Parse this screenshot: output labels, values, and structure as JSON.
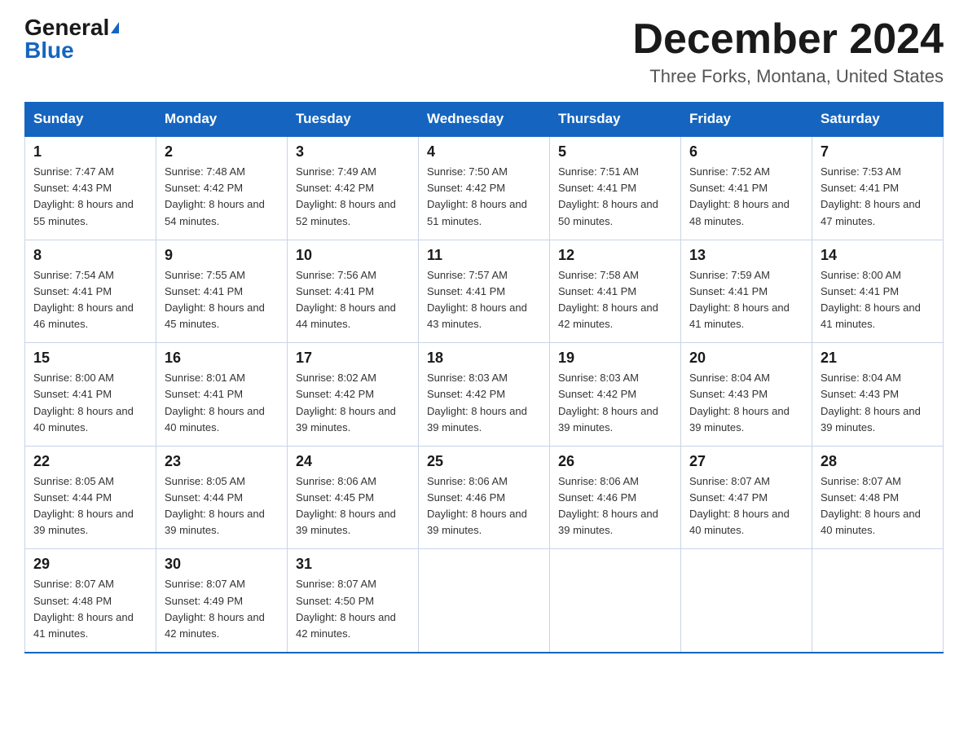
{
  "header": {
    "logo_general": "General",
    "logo_triangle": "▲",
    "logo_blue": "Blue",
    "month_title": "December 2024",
    "location": "Three Forks, Montana, United States"
  },
  "days_of_week": [
    "Sunday",
    "Monday",
    "Tuesday",
    "Wednesday",
    "Thursday",
    "Friday",
    "Saturday"
  ],
  "weeks": [
    [
      {
        "day": 1,
        "sunrise": "7:47 AM",
        "sunset": "4:43 PM",
        "daylight": "8 hours and 55 minutes."
      },
      {
        "day": 2,
        "sunrise": "7:48 AM",
        "sunset": "4:42 PM",
        "daylight": "8 hours and 54 minutes."
      },
      {
        "day": 3,
        "sunrise": "7:49 AM",
        "sunset": "4:42 PM",
        "daylight": "8 hours and 52 minutes."
      },
      {
        "day": 4,
        "sunrise": "7:50 AM",
        "sunset": "4:42 PM",
        "daylight": "8 hours and 51 minutes."
      },
      {
        "day": 5,
        "sunrise": "7:51 AM",
        "sunset": "4:41 PM",
        "daylight": "8 hours and 50 minutes."
      },
      {
        "day": 6,
        "sunrise": "7:52 AM",
        "sunset": "4:41 PM",
        "daylight": "8 hours and 48 minutes."
      },
      {
        "day": 7,
        "sunrise": "7:53 AM",
        "sunset": "4:41 PM",
        "daylight": "8 hours and 47 minutes."
      }
    ],
    [
      {
        "day": 8,
        "sunrise": "7:54 AM",
        "sunset": "4:41 PM",
        "daylight": "8 hours and 46 minutes."
      },
      {
        "day": 9,
        "sunrise": "7:55 AM",
        "sunset": "4:41 PM",
        "daylight": "8 hours and 45 minutes."
      },
      {
        "day": 10,
        "sunrise": "7:56 AM",
        "sunset": "4:41 PM",
        "daylight": "8 hours and 44 minutes."
      },
      {
        "day": 11,
        "sunrise": "7:57 AM",
        "sunset": "4:41 PM",
        "daylight": "8 hours and 43 minutes."
      },
      {
        "day": 12,
        "sunrise": "7:58 AM",
        "sunset": "4:41 PM",
        "daylight": "8 hours and 42 minutes."
      },
      {
        "day": 13,
        "sunrise": "7:59 AM",
        "sunset": "4:41 PM",
        "daylight": "8 hours and 41 minutes."
      },
      {
        "day": 14,
        "sunrise": "8:00 AM",
        "sunset": "4:41 PM",
        "daylight": "8 hours and 41 minutes."
      }
    ],
    [
      {
        "day": 15,
        "sunrise": "8:00 AM",
        "sunset": "4:41 PM",
        "daylight": "8 hours and 40 minutes."
      },
      {
        "day": 16,
        "sunrise": "8:01 AM",
        "sunset": "4:41 PM",
        "daylight": "8 hours and 40 minutes."
      },
      {
        "day": 17,
        "sunrise": "8:02 AM",
        "sunset": "4:42 PM",
        "daylight": "8 hours and 39 minutes."
      },
      {
        "day": 18,
        "sunrise": "8:03 AM",
        "sunset": "4:42 PM",
        "daylight": "8 hours and 39 minutes."
      },
      {
        "day": 19,
        "sunrise": "8:03 AM",
        "sunset": "4:42 PM",
        "daylight": "8 hours and 39 minutes."
      },
      {
        "day": 20,
        "sunrise": "8:04 AM",
        "sunset": "4:43 PM",
        "daylight": "8 hours and 39 minutes."
      },
      {
        "day": 21,
        "sunrise": "8:04 AM",
        "sunset": "4:43 PM",
        "daylight": "8 hours and 39 minutes."
      }
    ],
    [
      {
        "day": 22,
        "sunrise": "8:05 AM",
        "sunset": "4:44 PM",
        "daylight": "8 hours and 39 minutes."
      },
      {
        "day": 23,
        "sunrise": "8:05 AM",
        "sunset": "4:44 PM",
        "daylight": "8 hours and 39 minutes."
      },
      {
        "day": 24,
        "sunrise": "8:06 AM",
        "sunset": "4:45 PM",
        "daylight": "8 hours and 39 minutes."
      },
      {
        "day": 25,
        "sunrise": "8:06 AM",
        "sunset": "4:46 PM",
        "daylight": "8 hours and 39 minutes."
      },
      {
        "day": 26,
        "sunrise": "8:06 AM",
        "sunset": "4:46 PM",
        "daylight": "8 hours and 39 minutes."
      },
      {
        "day": 27,
        "sunrise": "8:07 AM",
        "sunset": "4:47 PM",
        "daylight": "8 hours and 40 minutes."
      },
      {
        "day": 28,
        "sunrise": "8:07 AM",
        "sunset": "4:48 PM",
        "daylight": "8 hours and 40 minutes."
      }
    ],
    [
      {
        "day": 29,
        "sunrise": "8:07 AM",
        "sunset": "4:48 PM",
        "daylight": "8 hours and 41 minutes."
      },
      {
        "day": 30,
        "sunrise": "8:07 AM",
        "sunset": "4:49 PM",
        "daylight": "8 hours and 42 minutes."
      },
      {
        "day": 31,
        "sunrise": "8:07 AM",
        "sunset": "4:50 PM",
        "daylight": "8 hours and 42 minutes."
      },
      null,
      null,
      null,
      null
    ]
  ]
}
